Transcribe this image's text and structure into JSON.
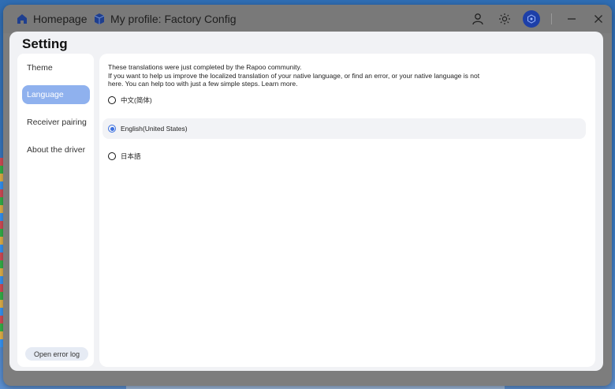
{
  "titlebar": {
    "home_label": "Homepage",
    "profile_label": "My profile: Factory Config",
    "icons": [
      "home-icon",
      "cube-icon",
      "user-icon",
      "brightness-icon",
      "brand-logo-icon",
      "minimize-icon",
      "close-icon"
    ]
  },
  "dialog": {
    "title": "Setting"
  },
  "sidebar": {
    "items": [
      {
        "label": "Theme",
        "active": false
      },
      {
        "label": "Language",
        "active": true
      },
      {
        "label": "Receiver pairing",
        "active": false
      },
      {
        "label": "About the driver",
        "active": false
      }
    ],
    "footer_button": "Open error log"
  },
  "content": {
    "intro_line1": "These translations were just completed by the Rapoo community.",
    "intro_line2": "If you want to help us improve the localized translation of your native language, or find an error, or your native language is not",
    "intro_line3": "here. You can help too with just a few simple steps. Learn more.",
    "languages": [
      {
        "label": "中文(简体)",
        "selected": false
      },
      {
        "label": "English(United States)",
        "selected": true
      },
      {
        "label": "日本語",
        "selected": false
      }
    ]
  },
  "colors": {
    "accent": "#3a6fe0",
    "active_item": "#8fb1ee",
    "brand": "#1d3fa8"
  }
}
